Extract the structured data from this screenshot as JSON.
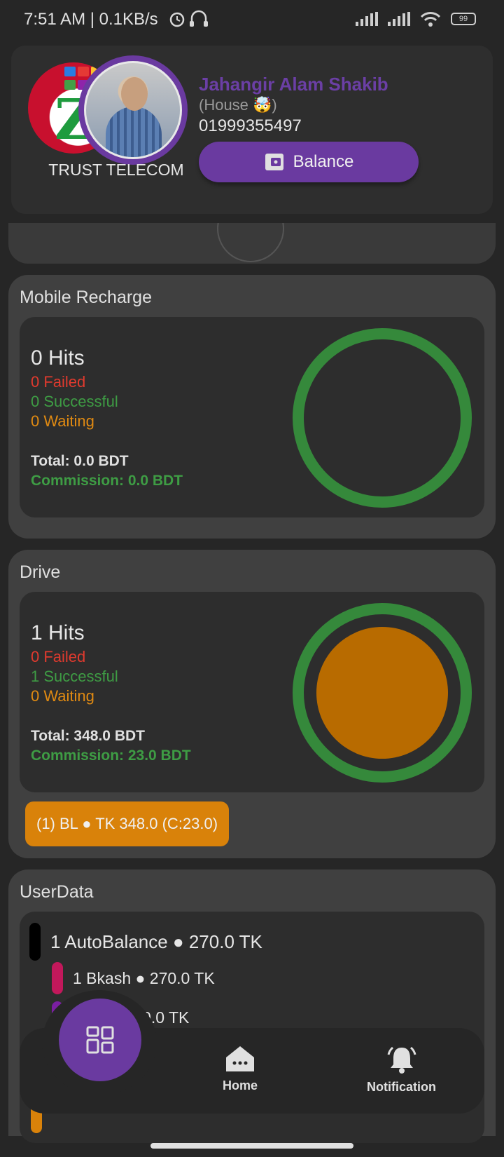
{
  "status_bar": {
    "time": "7:51 AM | 0.1KB/s",
    "battery": "99",
    "icons": [
      "alarm-icon",
      "headphones-icon",
      "signal-icon",
      "signal-icon",
      "wifi-icon",
      "battery-icon"
    ]
  },
  "profile": {
    "company_name": "TRUST TELECOM",
    "user_name": "Jahangir Alam Shakib",
    "user_role": "(House 🤯)",
    "phone": "01999355497",
    "balance_label": "Balance"
  },
  "mobile_recharge": {
    "title": "Mobile Recharge",
    "hits": "0 Hits",
    "failed": "0 Failed",
    "successful": "0 Successful",
    "waiting": "0 Waiting",
    "total": "Total: 0.0 BDT",
    "commission": "Commission: 0.0 BDT"
  },
  "drive": {
    "title": "Drive",
    "hits": "1 Hits",
    "failed": "0 Failed",
    "successful": "1 Successful",
    "waiting": "0 Waiting",
    "total": "Total: 348.0 BDT",
    "commission": "Commission: 23.0 BDT",
    "chip": "(1) BL ● TK 348.0 (C:23.0)"
  },
  "user_data": {
    "title": "UserData",
    "rows": [
      {
        "label": "1 AutoBalance ● 270.0 TK",
        "color": "#000000"
      },
      {
        "label": "1 Bkash ● 270.0 TK",
        "color": "#c2185b"
      },
      {
        "label": "t ● 0.0 TK",
        "color": "#7b1fa2"
      }
    ]
  },
  "bottom_nav": {
    "home_label": "Home",
    "notification_label": "Notification"
  },
  "colors": {
    "accent": "#6a3aa0",
    "success": "#35893b",
    "failed": "#e03a2e",
    "waiting": "#e08a12"
  }
}
